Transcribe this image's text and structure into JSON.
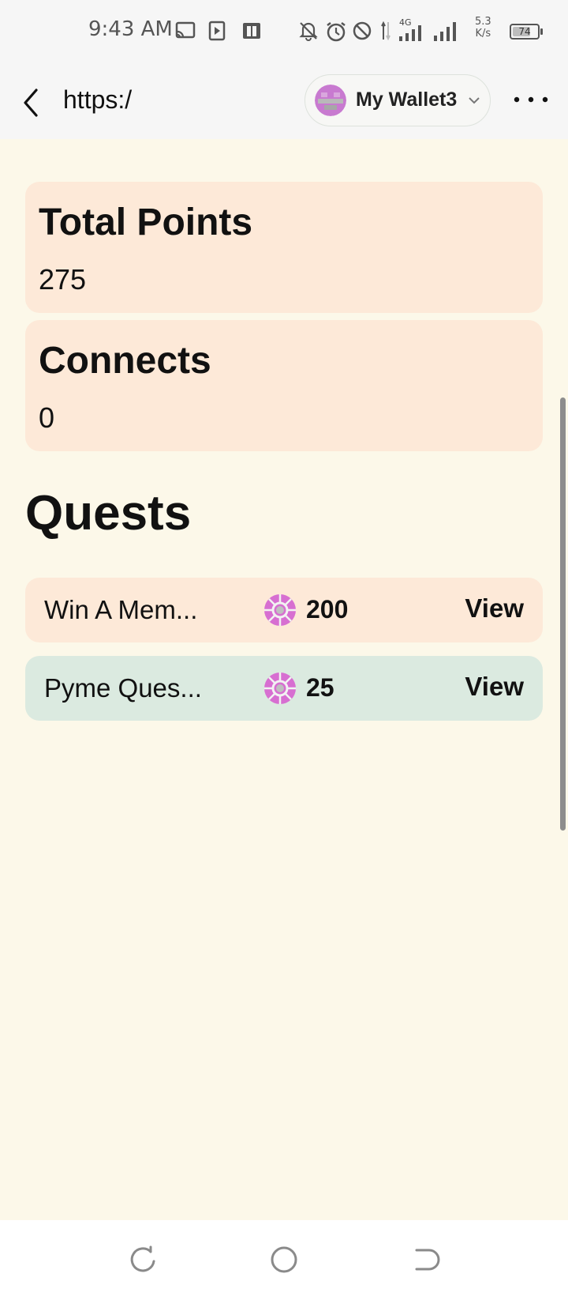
{
  "status_bar": {
    "time": "9:43 AM",
    "network_label": "4G",
    "speed_value": "5.3",
    "speed_unit": "K/s",
    "battery_level": "74",
    "battery_fraction": 0.74,
    "icons": [
      "screen-cast-icon",
      "video-icon",
      "app-badge-icon",
      "bell-off-icon",
      "alarm-icon",
      "do-not-disturb-icon",
      "signal-icon",
      "signal-icon",
      "battery-icon"
    ]
  },
  "nav": {
    "url": "https:/",
    "wallet_name": "My Wallet3"
  },
  "cards": [
    {
      "title": "Total Points",
      "value": "275"
    },
    {
      "title": "Connects",
      "value": "0"
    }
  ],
  "quests_heading": "Quests",
  "quests": [
    {
      "name": "Win A Mem...",
      "points": "200",
      "action": "View",
      "bg": "#fde9d8"
    },
    {
      "name": "Pyme Ques...",
      "points": "25",
      "action": "View",
      "bg": "#dbeae0"
    }
  ],
  "colors": {
    "page_bg": "#fcf8e9",
    "card_bg": "#fde9d8",
    "quest_green_bg": "#dbeae0",
    "token_icon": "#d76fd1"
  }
}
